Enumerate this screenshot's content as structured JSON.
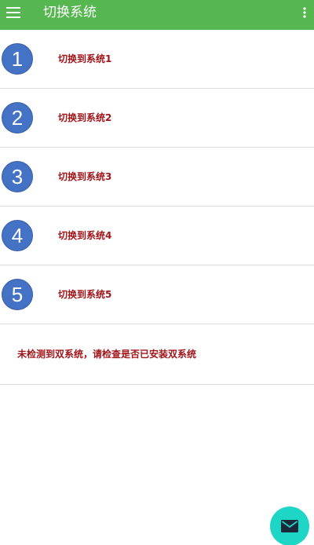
{
  "app_bar": {
    "title": "切换系统",
    "menu_icon": "menu-icon",
    "more_icon": "more-vert-icon",
    "background_color": "#56b64f"
  },
  "systems": [
    {
      "number": "1",
      "label": "切换到系统1"
    },
    {
      "number": "2",
      "label": "切换到系统2"
    },
    {
      "number": "3",
      "label": "切换到系统3"
    },
    {
      "number": "4",
      "label": "切换到系统4"
    },
    {
      "number": "5",
      "label": "切换到系统5"
    }
  ],
  "notice": {
    "text": "未检测到双系统，请检查是否已安装双系统"
  },
  "fab": {
    "icon": "mail-icon",
    "color": "#1ed6c6"
  },
  "colors": {
    "badge": "#4472c4",
    "label_text": "#a0151a"
  }
}
